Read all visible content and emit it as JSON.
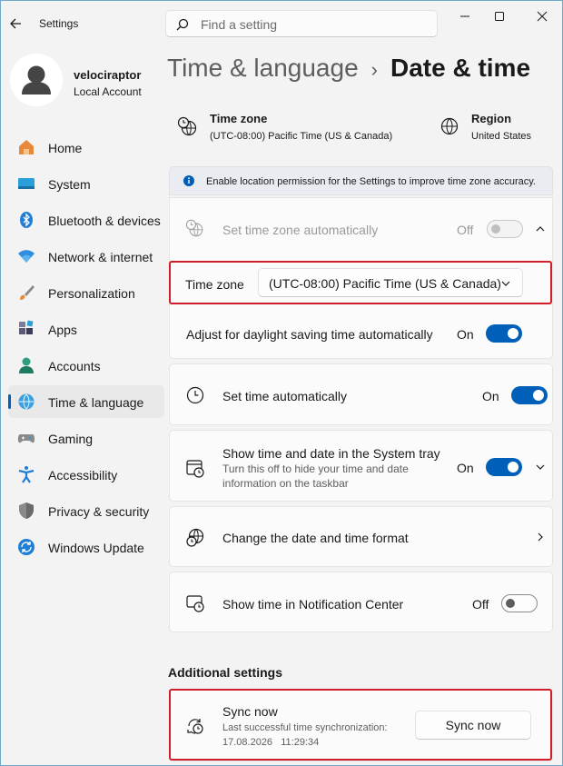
{
  "app": {
    "title": "Settings"
  },
  "search": {
    "placeholder": "Find a setting"
  },
  "profile": {
    "name": "velociraptor",
    "account_type": "Local Account"
  },
  "nav": {
    "items": [
      {
        "label": "Home",
        "icon": "home-icon"
      },
      {
        "label": "System",
        "icon": "system-icon"
      },
      {
        "label": "Bluetooth & devices",
        "icon": "bluetooth-icon"
      },
      {
        "label": "Network & internet",
        "icon": "wifi-icon"
      },
      {
        "label": "Personalization",
        "icon": "brush-icon"
      },
      {
        "label": "Apps",
        "icon": "apps-icon"
      },
      {
        "label": "Accounts",
        "icon": "accounts-icon"
      },
      {
        "label": "Time & language",
        "icon": "time-language-icon",
        "active": true
      },
      {
        "label": "Gaming",
        "icon": "gamepad-icon"
      },
      {
        "label": "Accessibility",
        "icon": "accessibility-icon"
      },
      {
        "label": "Privacy & security",
        "icon": "shield-icon"
      },
      {
        "label": "Windows Update",
        "icon": "update-icon"
      }
    ]
  },
  "breadcrumb": {
    "parent": "Time & language",
    "separator": "›",
    "current": "Date & time"
  },
  "summary": {
    "timezone": {
      "title": "Time zone",
      "value": "(UTC-08:00) Pacific Time (US & Canada)"
    },
    "region": {
      "title": "Region",
      "value": "United States"
    }
  },
  "banner": {
    "text": "Enable location permission for the Settings to improve time zone accuracy."
  },
  "settings": {
    "auto_timezone": {
      "label": "Set time zone automatically",
      "state": "Off"
    },
    "timezone_select": {
      "label": "Time zone",
      "value": "(UTC-08:00) Pacific Time (US & Canada)"
    },
    "dst": {
      "label": "Adjust for daylight saving time automatically",
      "state": "On"
    },
    "auto_time": {
      "label": "Set time automatically",
      "state": "On"
    },
    "tray": {
      "label": "Show time and date in the System tray",
      "desc_line1": "Turn this off to hide your time and date",
      "desc_line2": "information on the taskbar",
      "state": "On"
    },
    "format": {
      "label": "Change the date and time format"
    },
    "notification": {
      "label": "Show time in Notification Center",
      "state": "Off"
    }
  },
  "additional": {
    "heading": "Additional settings",
    "sync": {
      "label": "Sync now",
      "desc_line1": "Last successful time synchronization:",
      "desc_line2": "17.08.2026   11:29:34",
      "button": "Sync now"
    }
  },
  "colors": {
    "accent": "#005fb8",
    "highlight": "#d11e2b"
  }
}
